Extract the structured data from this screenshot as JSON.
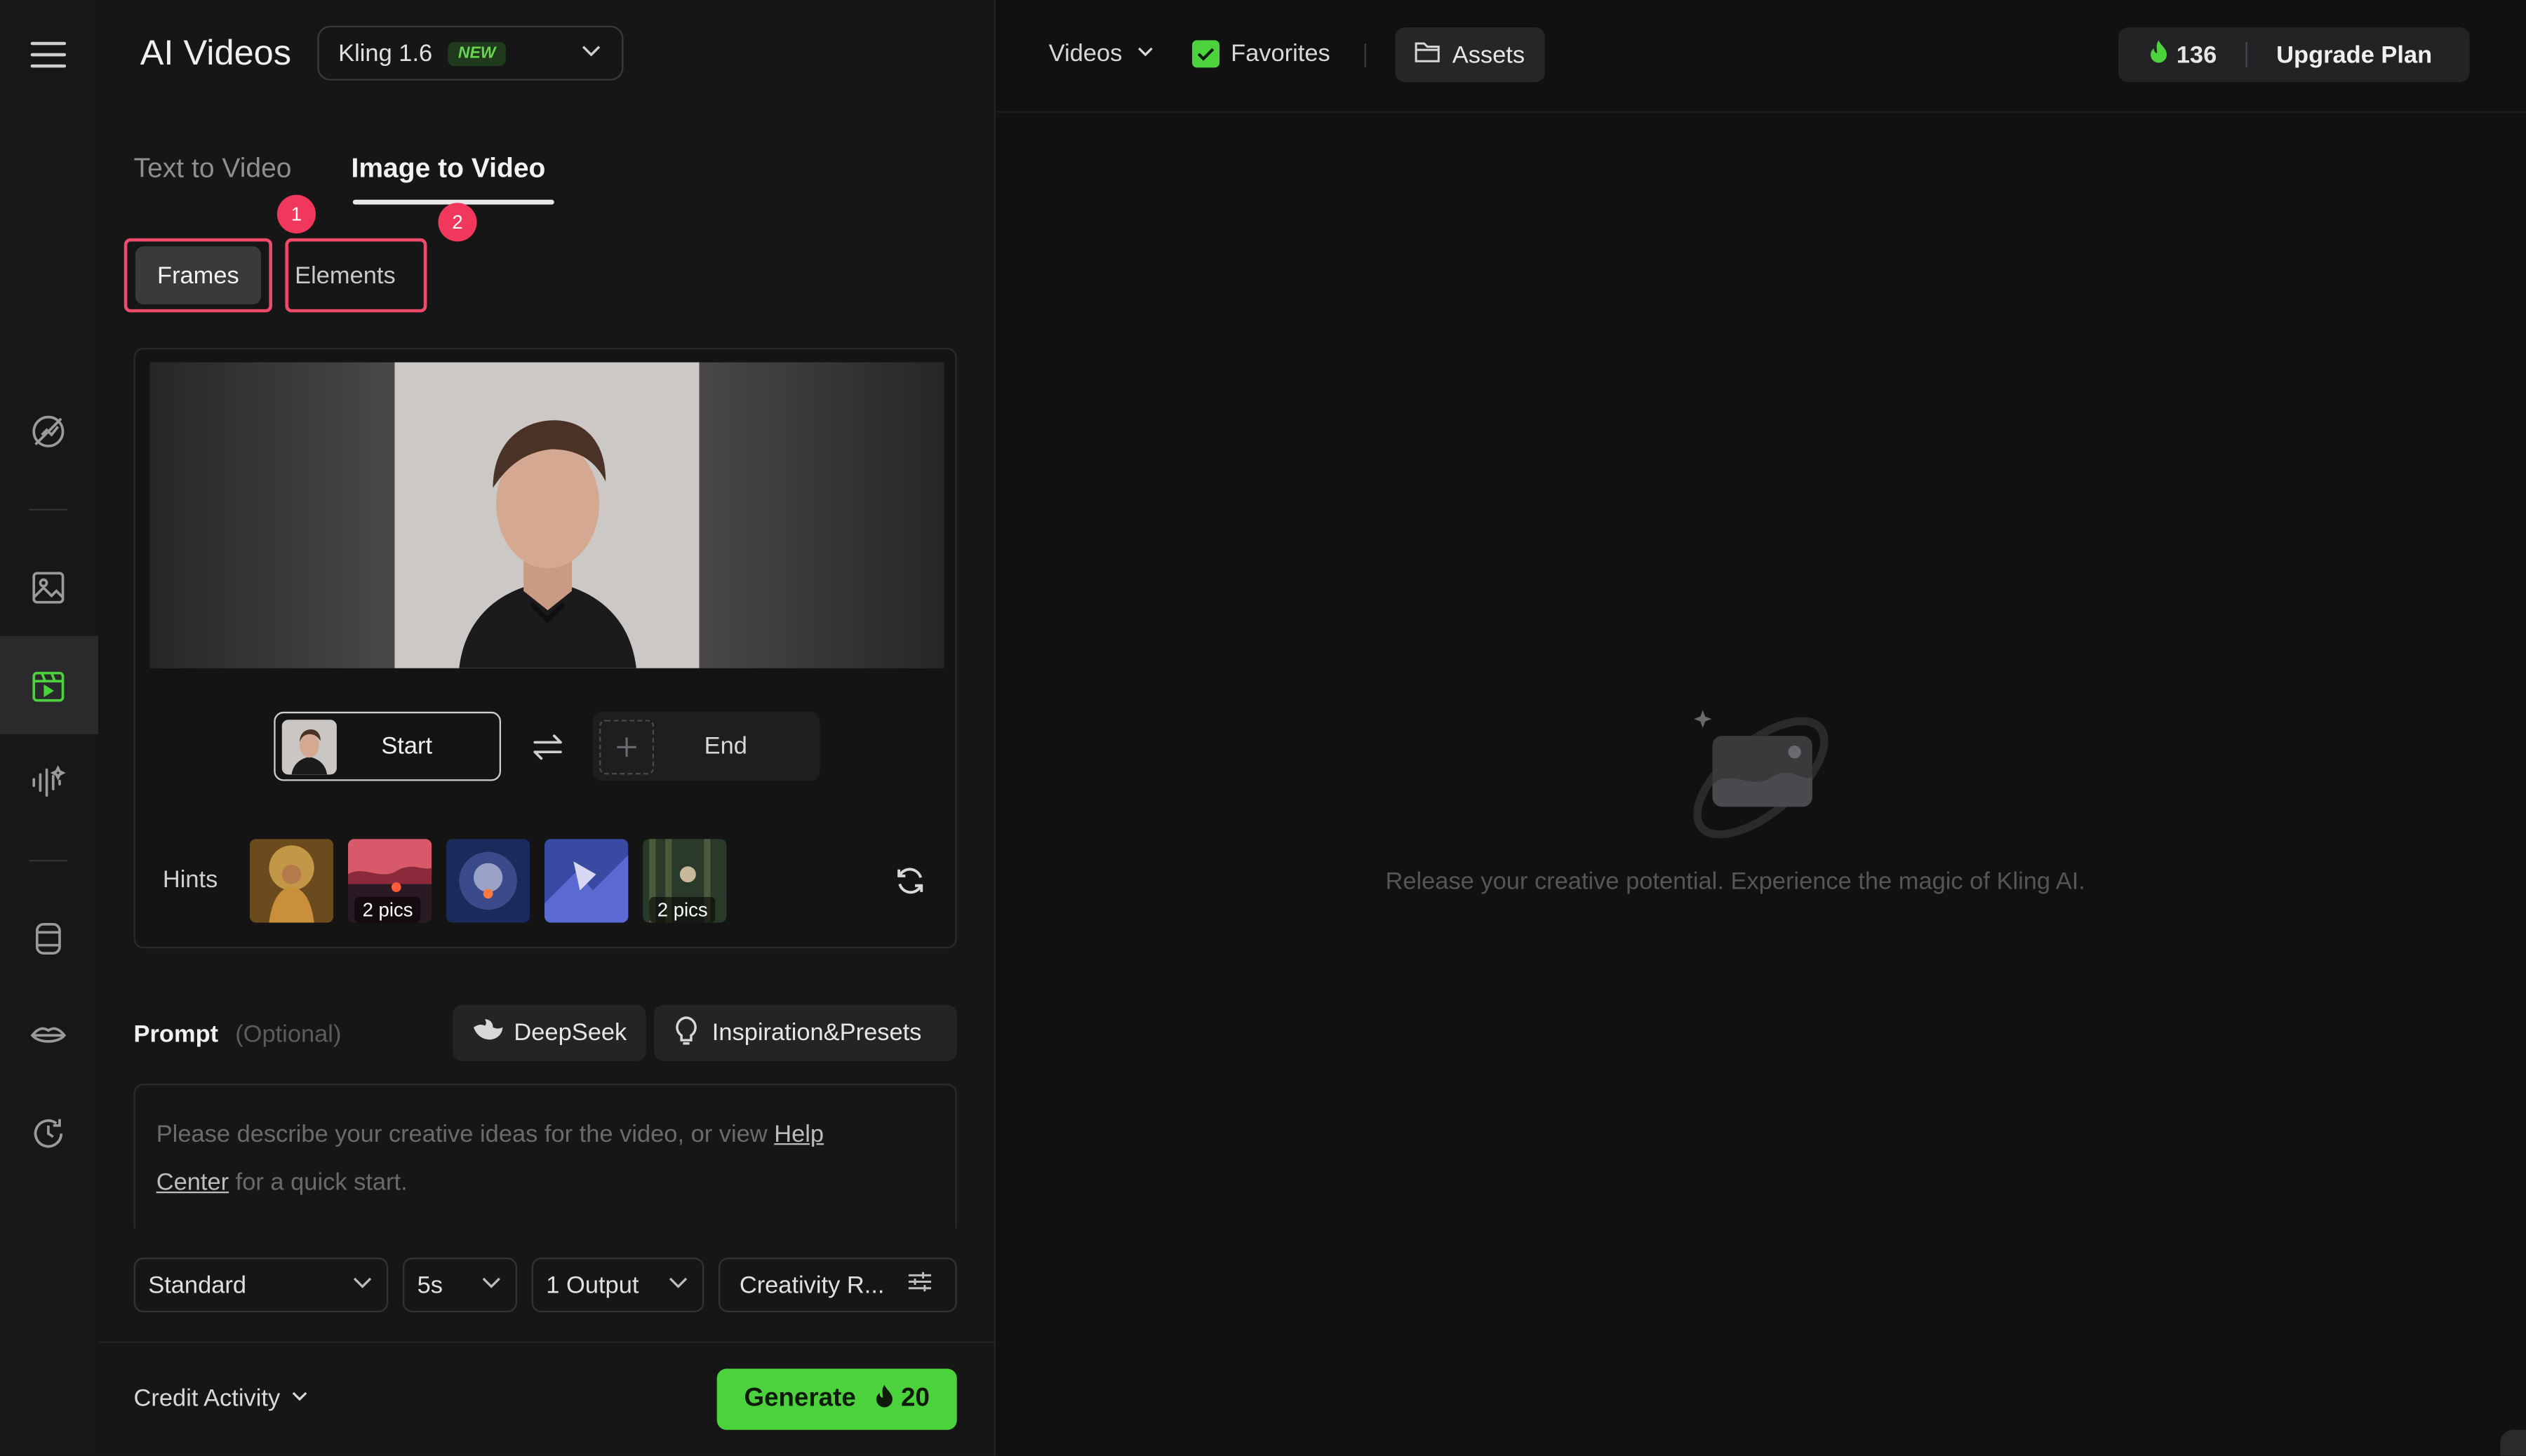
{
  "header": {
    "title": "AI Videos",
    "model": "Kling 1.6",
    "model_badge": "NEW"
  },
  "tabs": [
    {
      "label": "Text to Video",
      "active": false
    },
    {
      "label": "Image to Video",
      "active": true
    }
  ],
  "segment": {
    "frames_label": "Frames",
    "elements_label": "Elements",
    "annotation_1": "1",
    "annotation_2": "2"
  },
  "frames": {
    "start_label": "Start",
    "end_label": "End",
    "hints_label": "Hints",
    "hints": [
      {
        "name": "golden-figure",
        "pics": ""
      },
      {
        "name": "red-sky-scene",
        "pics": "2 pics"
      },
      {
        "name": "astronaut-planet",
        "pics": ""
      },
      {
        "name": "flying-figure",
        "pics": ""
      },
      {
        "name": "forest-scene",
        "pics": "2 pics"
      }
    ]
  },
  "prompt": {
    "label": "Prompt",
    "optional": "(Optional)",
    "deepseek": "DeepSeek",
    "inspiration": "Inspiration&Presets",
    "placeholder_a": "Please describe your creative ideas for the video, or view ",
    "link_a": "Help",
    "link_b": "Center",
    "placeholder_b": " for a quick start."
  },
  "options": {
    "mode": "Standard",
    "duration": "5s",
    "outputs": "1 Output",
    "creativity": "Creativity R..."
  },
  "footer": {
    "credit_activity": "Credit Activity",
    "generate_label": "Generate",
    "generate_cost": "20"
  },
  "topbar": {
    "videos": "Videos",
    "favorites": "Favorites",
    "assets": "Assets",
    "credits": "136",
    "upgrade": "Upgrade Plan"
  },
  "empty_state": {
    "message": "Release your creative potential. Experience the magic of Kling AI."
  },
  "colors": {
    "accent_green": "#4cd23c",
    "annotation_red": "#f0385c"
  }
}
